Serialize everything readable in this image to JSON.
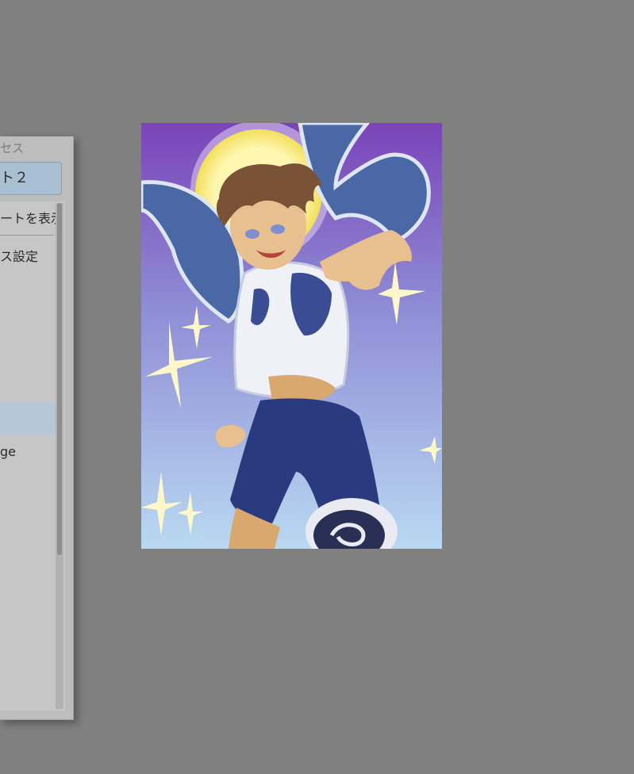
{
  "panel": {
    "title": "セス",
    "button_label": "ト２",
    "menu": {
      "item_1": "ートを表示",
      "item_2": "ス設定",
      "item_3": "ge"
    }
  },
  "canvas": {
    "description_icon": "illustration",
    "colors": {
      "sky_top": "#7b44b8",
      "sky_mid": "#8f8fd6",
      "sky_bottom": "#b9d9f2",
      "moon": "#f6e86a",
      "wing": "#4b68a6",
      "shorts": "#2a3a7e",
      "skin": "#d8a86e",
      "hair": "#7a5236",
      "sparkle": "#fff7c9"
    }
  }
}
